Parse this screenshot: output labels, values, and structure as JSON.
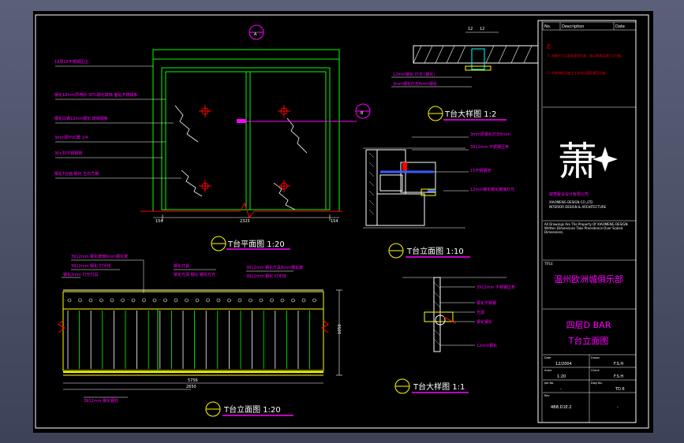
{
  "views": {
    "top_plan_title": "T台平面图 1:20",
    "top_elevation_title": "T台立面图 1:20",
    "side_elevation_title": "T台立面图 1:10",
    "detail_top_title": "T台大样图 1:2",
    "detail_small_title": "T台大样图 1:1",
    "dim_top_left": "154",
    "dim_top_mid": "2325",
    "dim_top_right": "154",
    "dim_elev_left": "2650",
    "dim_elev_total": "5756",
    "dim_elev_height": "1050",
    "dim_detail_a": "12",
    "dim_detail_b": "12"
  },
  "annotations_plan": [
    "18厚15不锈钢压边",
    "钢化18mm厚喷砂 30%钢化玻璃 面贴不锈钢条",
    "钢化白钢12mm钢化 玻璃钢条",
    "3mm厚PVC膜 1/4",
    "30x30不锈钢管",
    "钢化T台面 钢化 玉石方钢"
  ],
  "annotations_elev": [
    "3912mm 钢化玻璃6mm钢化玻",
    "3912mm 钢化 灯光线",
    "钢化2mm 灯光灯具",
    "钢化灯具",
    "钢化光源 钢化 钢化灯光",
    "3912mm 钢化灯具6mm钢化玻",
    "3912mm 钢化 灯光线",
    "3912mm 钢化钢柱"
  ],
  "annotations_side": [
    "3mm厚钢化灯光6mm",
    "3912mm 不锈钢压条",
    "钢化钢条",
    "钢化不锈钢管",
    "15不锈钢管",
    "12mm钢化钢化玻璃灯光"
  ],
  "annotations_detail": [
    "12mm钢化 灯光 (钢化)",
    "3mm钢化灯光6mm钢化",
    "钢化不锈钢",
    "光源",
    "钢化钢化",
    "12mm钢化"
  ],
  "title_block": {
    "header_left": "No.",
    "header_mid": "Description",
    "header_right": "Date",
    "notes_label": "注:",
    "note_1": "1. 本图尺寸以实际现场为准，误以现场实测尺寸为准。",
    "note_2": "2. 所有材料及施工工艺均以国家规范为准。",
    "logo_glyph": "萧",
    "company_cn": "肆萧蒙设设计有限公司",
    "company_en_1": "XIAOMENG DESIGN CO.,LTD",
    "company_en_2": "INTERIOR DESIGN & ARCHITECTURE",
    "copyright": "All Drawings Are The Property Of XIAOMENG DESIGN. Written Dimensions Take Precedence Over Scaled Dimensions.",
    "project_label": "TITLE",
    "project_name": "温州欧洲城俱乐部",
    "drawing_name_1": "四层D BAR",
    "drawing_name_2": "T台立面图",
    "row1_label": "Date",
    "row1_value": "12/2004",
    "row1_label2": "Drawn",
    "row1_value2": "F.S.H",
    "row2_label": "Scale",
    "row2_value": "1:20",
    "row2_label2": "Check",
    "row2_value2": "F.S.H",
    "row3_label": "Job No.",
    "row3_value": "-",
    "row3_label2": "Dwg No.",
    "row3_value2": "TD.6",
    "row4_label": "Rev",
    "row4_value": "4BB.D1E.2",
    "row4_value2": "-"
  },
  "colors": {
    "background": "#000000",
    "green": "#00ff00",
    "yellow": "#ffff00",
    "magenta": "#ff00ff",
    "white": "#ffffff",
    "cyan": "#00ffff",
    "red": "#ff0000",
    "blue": "#3a5bff"
  }
}
